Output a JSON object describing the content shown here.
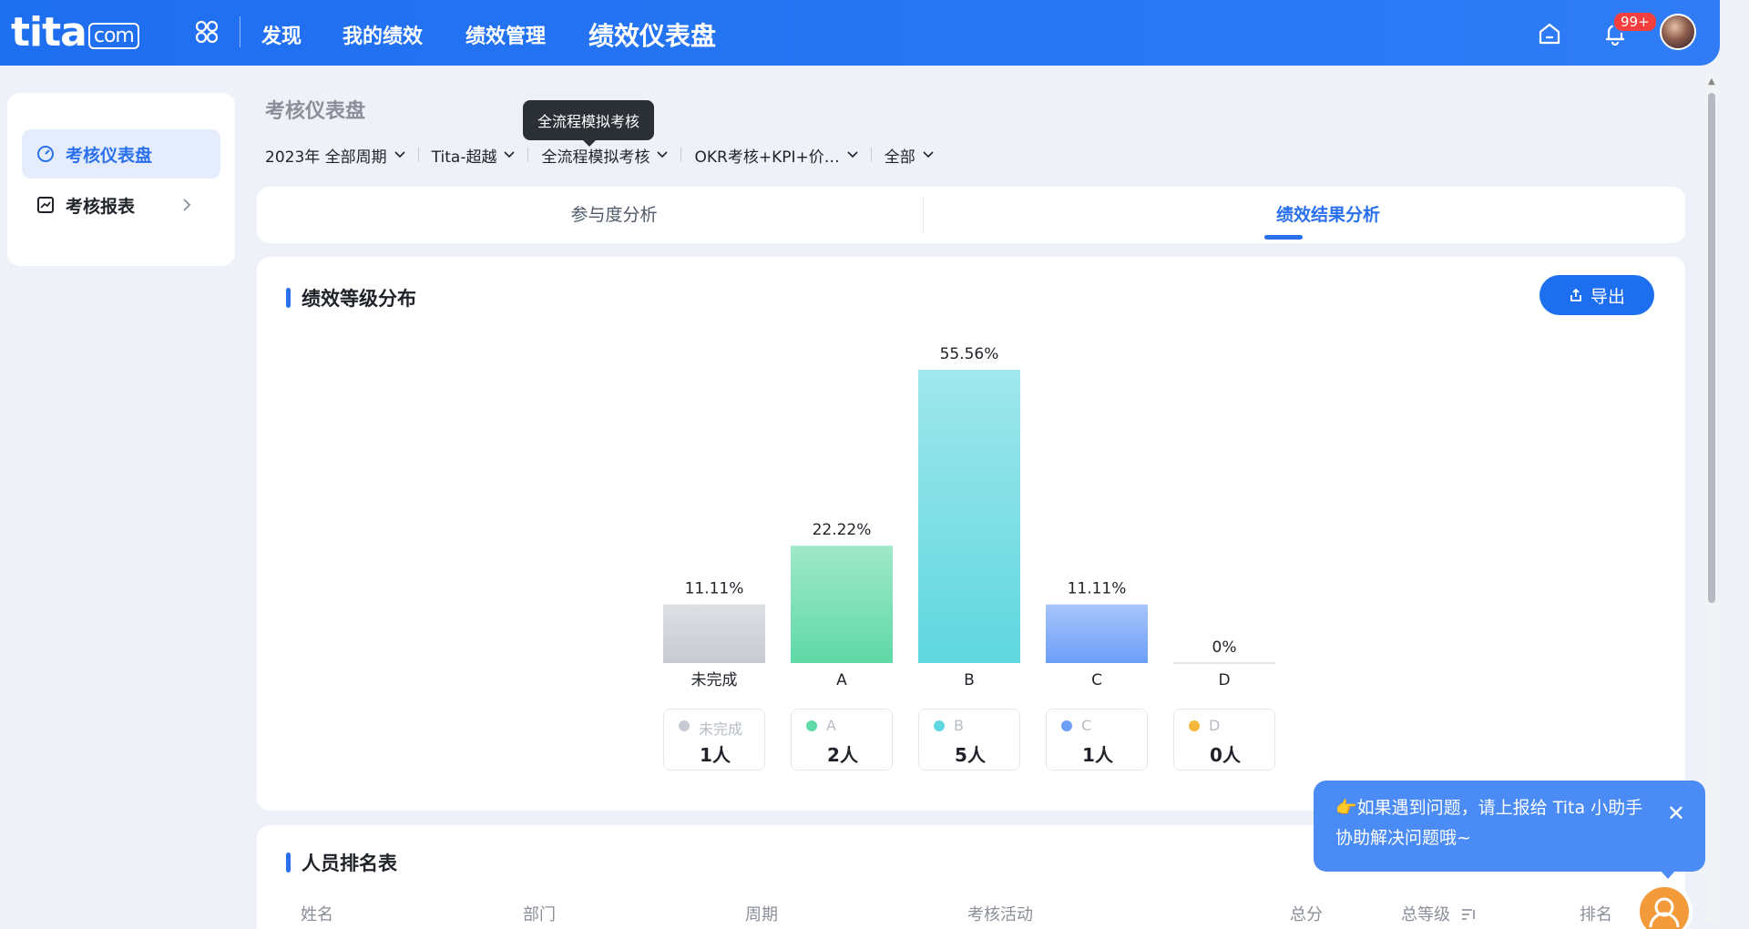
{
  "nav": {
    "logo": "tita",
    "logo_suffix": "com",
    "items": [
      "发现",
      "我的绩效",
      "绩效管理",
      "绩效仪表盘"
    ],
    "badge": "99+"
  },
  "sidebar": {
    "items": [
      {
        "label": "考核仪表盘",
        "icon": "gauge-icon"
      },
      {
        "label": "考核报表",
        "icon": "chart-report-icon"
      }
    ]
  },
  "page": {
    "title": "考核仪表盘",
    "tooltip": "全流程模拟考核",
    "filters": [
      "2023年 全部周期",
      "Tita-超越",
      "全流程模拟考核",
      "OKR考核+KPI+价…",
      "全部"
    ]
  },
  "tabs": [
    "参与度分析",
    "绩效结果分析"
  ],
  "grade_section": {
    "title": "绩效等级分布",
    "export_label": "导出"
  },
  "chart_data": {
    "type": "bar",
    "title": "绩效等级分布",
    "categories": [
      "未完成",
      "A",
      "B",
      "C",
      "D"
    ],
    "values": [
      11.11,
      22.22,
      55.56,
      11.11,
      0
    ],
    "value_labels": [
      "11.11%",
      "22.22%",
      "55.56%",
      "11.11%",
      "0%"
    ],
    "counts": [
      "1人",
      "2人",
      "5人",
      "1人",
      "0人"
    ],
    "colors": [
      "#c7cad2",
      "#5fd9a6",
      "#5fd7df",
      "#6d9ef8",
      "#f5b73b"
    ],
    "ylim": [
      0,
      55.56
    ],
    "xlabel": "",
    "ylabel": "",
    "grid": false
  },
  "ranking": {
    "title": "人员排名表",
    "columns": [
      "姓名",
      "部门",
      "周期",
      "考核活动",
      "总分",
      "总等级",
      "排名"
    ]
  },
  "help": {
    "line1": "👉如果遇到问题，请上报给 Tita 小助手",
    "line2": "协助解决问题哦~",
    "close": "✕"
  }
}
